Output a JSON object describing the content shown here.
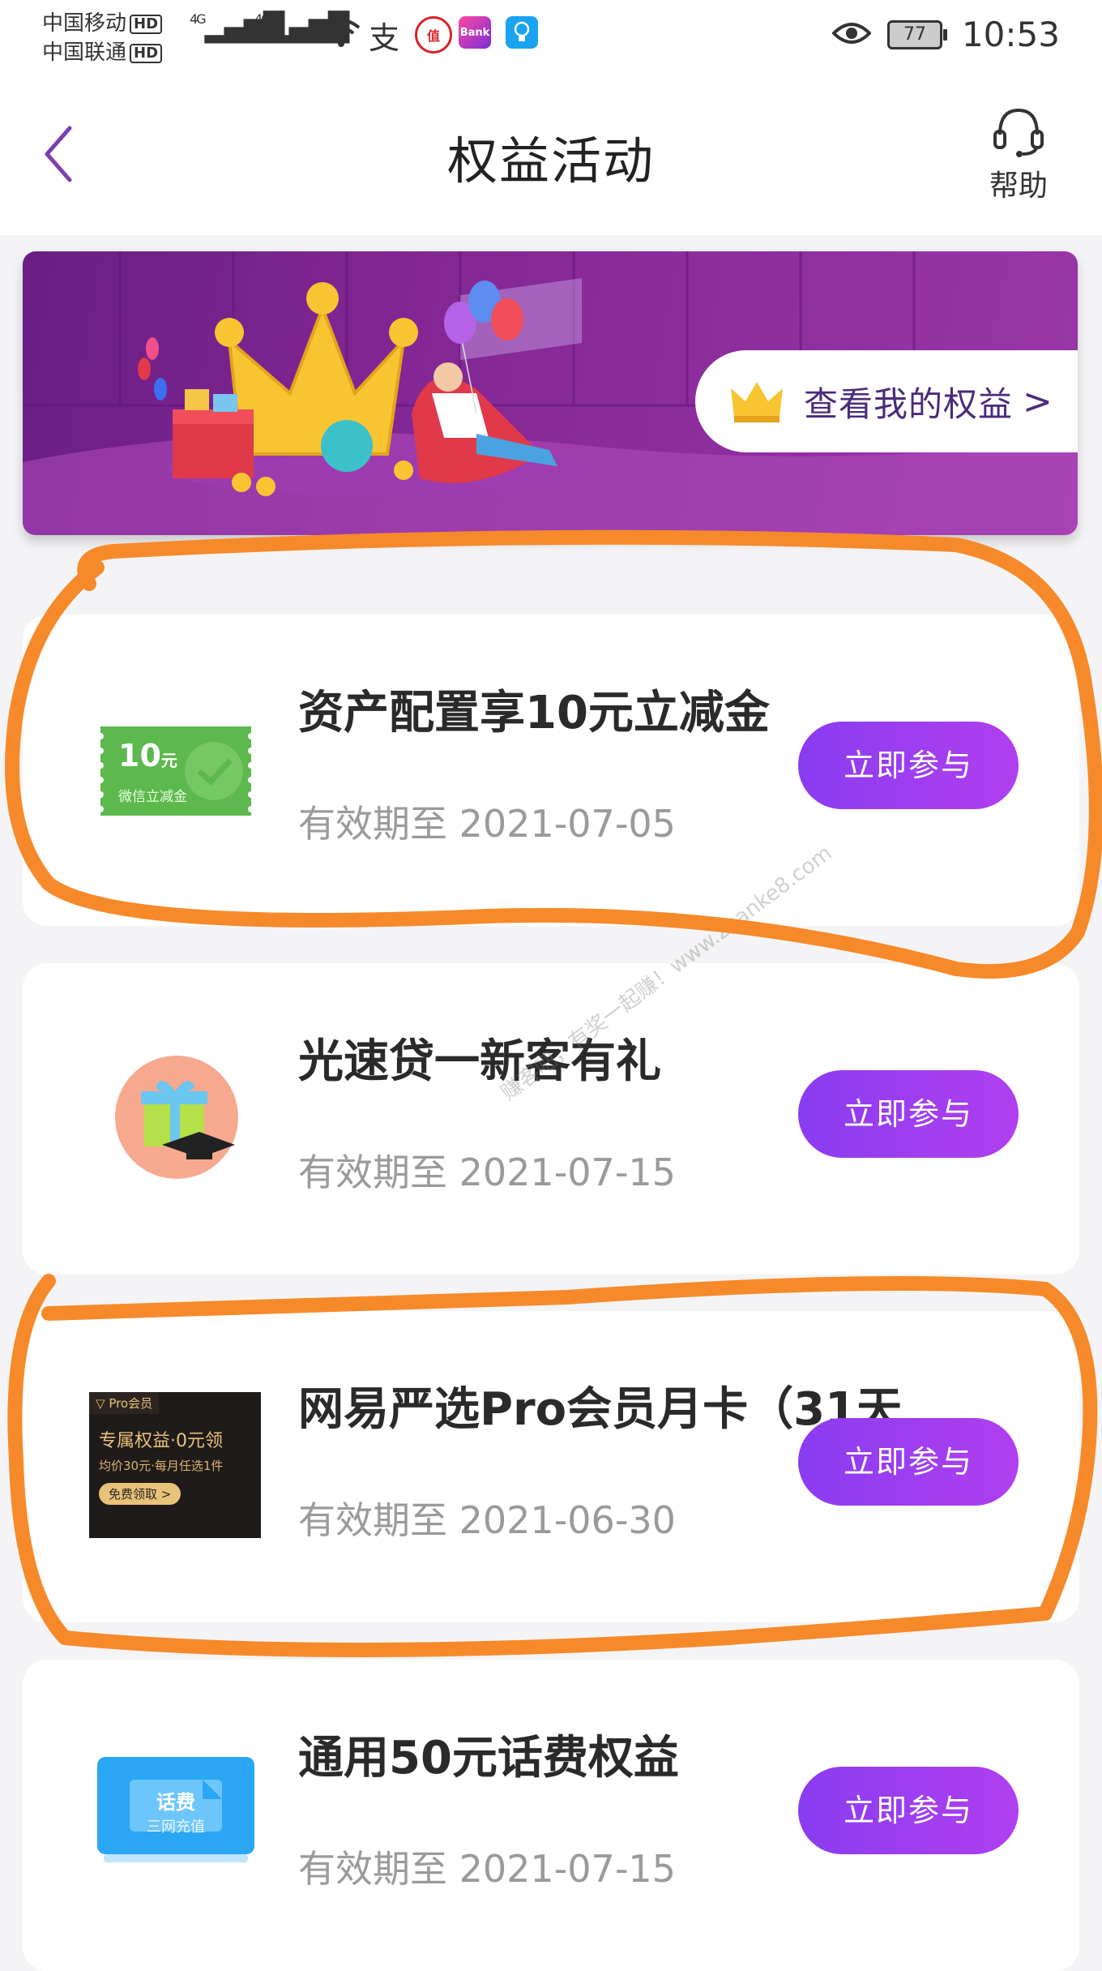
{
  "status_bar": {
    "carrier1": "中国移动",
    "carrier2": "中国联通",
    "hd": "HD",
    "net1": "4G",
    "net2": "4G",
    "app_bank": "Bank",
    "app_zhi": "值",
    "battery": "77",
    "time": "10:53"
  },
  "header": {
    "title": "权益活动",
    "help": "帮助"
  },
  "banner": {
    "cta": "查看我的权益",
    "chevron": ">"
  },
  "cards": [
    {
      "title": "资产配置享10元立减金",
      "expiry": "有效期至 2021-07-05",
      "button": "立即参与",
      "thumb": {
        "big": "10",
        "unit": "元",
        "sub": "微信立减金"
      }
    },
    {
      "title": "光速贷一新客有礼",
      "expiry": "有效期至 2021-07-15",
      "button": "立即参与"
    },
    {
      "title": "网易严选Pro会员月卡（31天",
      "expiry": "有效期至 2021-06-30",
      "button": "立即参与",
      "thumb": {
        "tag": "Pro会员",
        "line1": "专属权益·0元领",
        "line2": "均价30元·每月任选1件",
        "cta": "免费领取 >"
      }
    },
    {
      "title": "通用50元话费权益",
      "expiry": "有效期至 2021-07-15",
      "button": "立即参与",
      "thumb": {
        "title": "话费",
        "sub": "三网充值"
      }
    }
  ],
  "watermark": "赚客吧，有奖一起赚！www.zuanke8.com",
  "colors": {
    "accent_purple": "#9b3cf0",
    "banner_purple": "#842896",
    "annotation_orange": "#f68a2b"
  }
}
